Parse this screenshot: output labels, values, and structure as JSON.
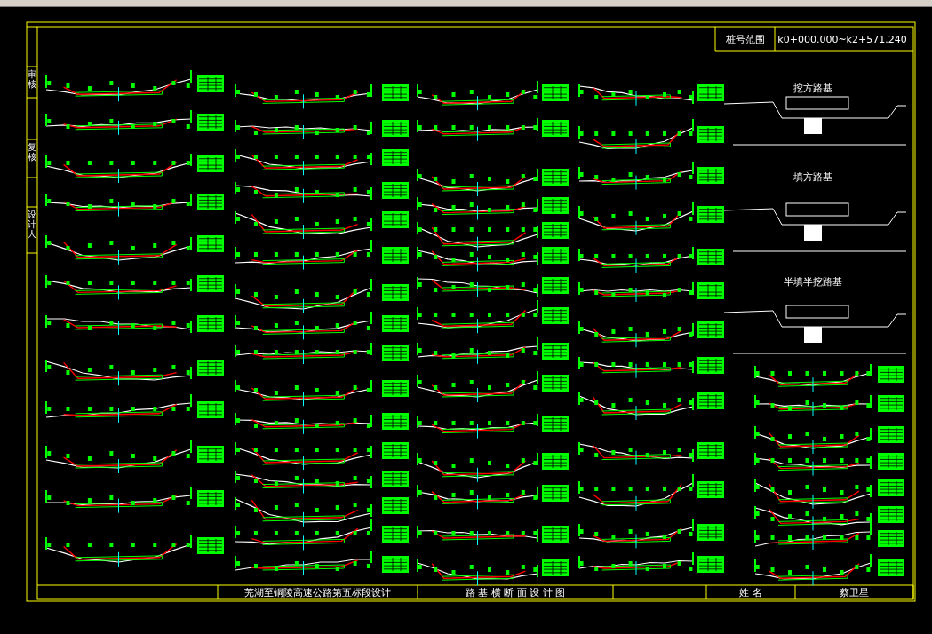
{
  "title_block": {
    "label": "桩号范围",
    "value": "k0+000.000~k2+571.240"
  },
  "side_labels": [
    {
      "text": "审核"
    },
    {
      "text": "复核"
    },
    {
      "text": "设计人"
    }
  ],
  "typical_sections": [
    {
      "title": "挖方路基"
    },
    {
      "title": "填方路基"
    },
    {
      "title": "半填半挖路基"
    }
  ],
  "footer": [
    {
      "text": "芜湖至铜陵高速公路第五标段设计"
    },
    {
      "text": "路 基 横 断 面 设 计 图"
    },
    {
      "text": "姓 名"
    },
    {
      "text": "蔡卫星"
    }
  ]
}
